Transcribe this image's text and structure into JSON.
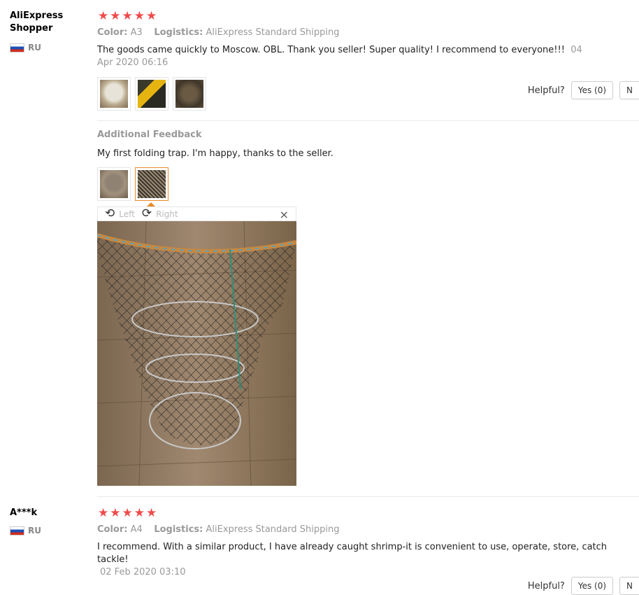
{
  "colors": {
    "star": "#f04b4b",
    "active_thumb": "#e88a2a"
  },
  "reviews": [
    {
      "user": "AliExpress Shopper",
      "country": "RU",
      "stars": 5,
      "color_key": "Color:",
      "color_val": "A3",
      "logistics_key": "Logistics:",
      "logistics_val": "AliExpress Standard Shipping",
      "text": "The goods came quickly to Moscow. OBL. Thank you seller! Super quality! I recommend to everyone!!!",
      "date": "04 Apr 2020 06:16",
      "helpful_label": "Helpful?",
      "yes_label": "Yes (0)",
      "no_label": "N",
      "additional_title": "Additional Feedback",
      "additional_text": "My first folding trap. I'm happy, thanks to the seller.",
      "viewer": {
        "left_label": "Left",
        "right_label": "Right",
        "close": "×"
      }
    },
    {
      "user": "A***k",
      "country": "RU",
      "stars": 5,
      "color_key": "Color:",
      "color_val": "A4",
      "logistics_key": "Logistics:",
      "logistics_val": "AliExpress Standard Shipping",
      "text": "I recommend. With a similar product, I have already caught shrimp-it is convenient to use, operate, store, catch tackle!",
      "date": "02 Feb 2020 03:10",
      "helpful_label": "Helpful?",
      "yes_label": "Yes (0)",
      "no_label": "N"
    }
  ]
}
